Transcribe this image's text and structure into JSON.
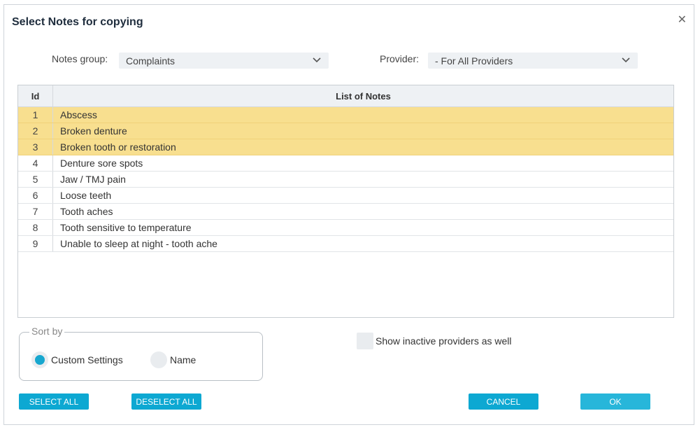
{
  "dialog": {
    "title": "Select Notes for copying"
  },
  "filters": {
    "notes_group_label": "Notes group:",
    "notes_group_value": "Complaints",
    "provider_label": "Provider:",
    "provider_value": "- For All Providers"
  },
  "grid": {
    "columns": [
      "Id",
      "List of Notes"
    ],
    "rows": [
      {
        "id": "1",
        "name": "Abscess",
        "selected": true
      },
      {
        "id": "2",
        "name": "Broken denture",
        "selected": true
      },
      {
        "id": "3",
        "name": "Broken tooth or restoration",
        "selected": true
      },
      {
        "id": "4",
        "name": "Denture sore spots",
        "selected": false
      },
      {
        "id": "5",
        "name": "Jaw / TMJ pain",
        "selected": false
      },
      {
        "id": "6",
        "name": "Loose teeth",
        "selected": false
      },
      {
        "id": "7",
        "name": "Tooth aches",
        "selected": false
      },
      {
        "id": "8",
        "name": "Tooth sensitive to temperature",
        "selected": false
      },
      {
        "id": "9",
        "name": "Unable to sleep at night - tooth ache",
        "selected": false
      }
    ]
  },
  "sort": {
    "legend": "Sort by",
    "option_custom": "Custom Settings",
    "option_name": "Name",
    "selected": "custom"
  },
  "inactive": {
    "label": "Show inactive providers as well",
    "checked": false
  },
  "buttons": {
    "select_all": "SELECT ALL",
    "deselect_all": "DESELECT ALL",
    "cancel": "CANCEL",
    "ok": "OK"
  },
  "colors": {
    "accent": "#0da8d2",
    "selected_row": "#f8df8f"
  }
}
